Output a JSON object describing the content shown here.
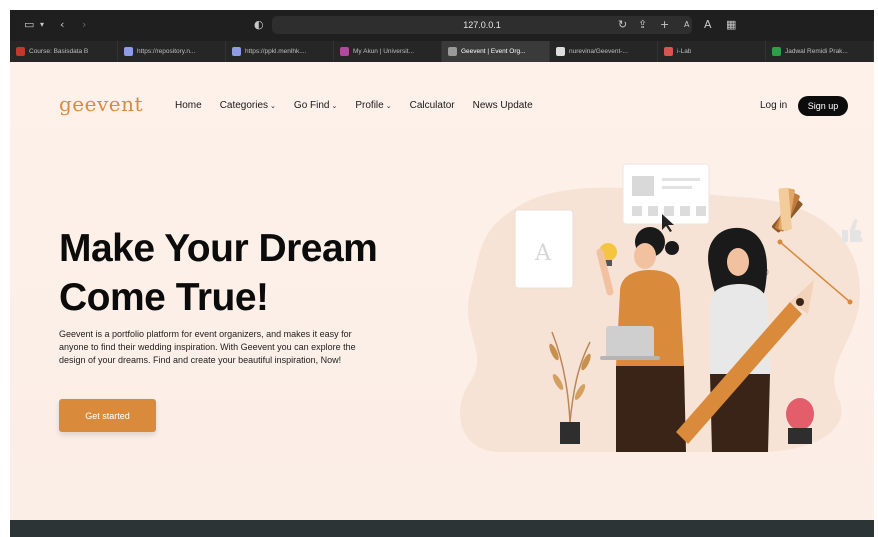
{
  "browser": {
    "url": "127.0.0.1",
    "tabs": [
      {
        "label": "Course: Basisdata B",
        "color": "#c0392b",
        "active": false
      },
      {
        "label": "https://repository.n...",
        "color": "#8e9ce6",
        "active": false
      },
      {
        "label": "https://ppkl.menlhk....",
        "color": "#8e9ce6",
        "active": false
      },
      {
        "label": "My Akun | Universit...",
        "color": "#b04aa0",
        "active": false
      },
      {
        "label": "Geevent | Event Org...",
        "color": "#999999",
        "active": true
      },
      {
        "label": "nurevina/Geevent-...",
        "color": "#dddddd",
        "active": false
      },
      {
        "label": "i-Lab",
        "color": "#d9534f",
        "active": false
      },
      {
        "label": "Jadwal Remidi Prak...",
        "color": "#2e9e48",
        "active": false
      }
    ]
  },
  "header": {
    "logo": "geevent",
    "nav": [
      {
        "label": "Home",
        "dropdown": false
      },
      {
        "label": "Categories",
        "dropdown": true
      },
      {
        "label": "Go Find",
        "dropdown": true
      },
      {
        "label": "Profile",
        "dropdown": true
      },
      {
        "label": "Calculator",
        "dropdown": false
      },
      {
        "label": "News Update",
        "dropdown": false
      }
    ],
    "login": "Log in",
    "signup": "Sign up"
  },
  "hero": {
    "title_line1": "Make Your Dream",
    "title_line2": "Come True!",
    "description": "Geevent is a portfolio platform for event organizers, and makes it easy for anyone to find their wedding inspiration. With Geevent you can explore the design of your dreams. Find and create your beautiful inspiration, Now!",
    "cta": "Get started",
    "illustration_letter": "A"
  },
  "colors": {
    "accent": "#d98a3a",
    "dark": "#0c0c0c",
    "background": "#fdf1ea"
  }
}
